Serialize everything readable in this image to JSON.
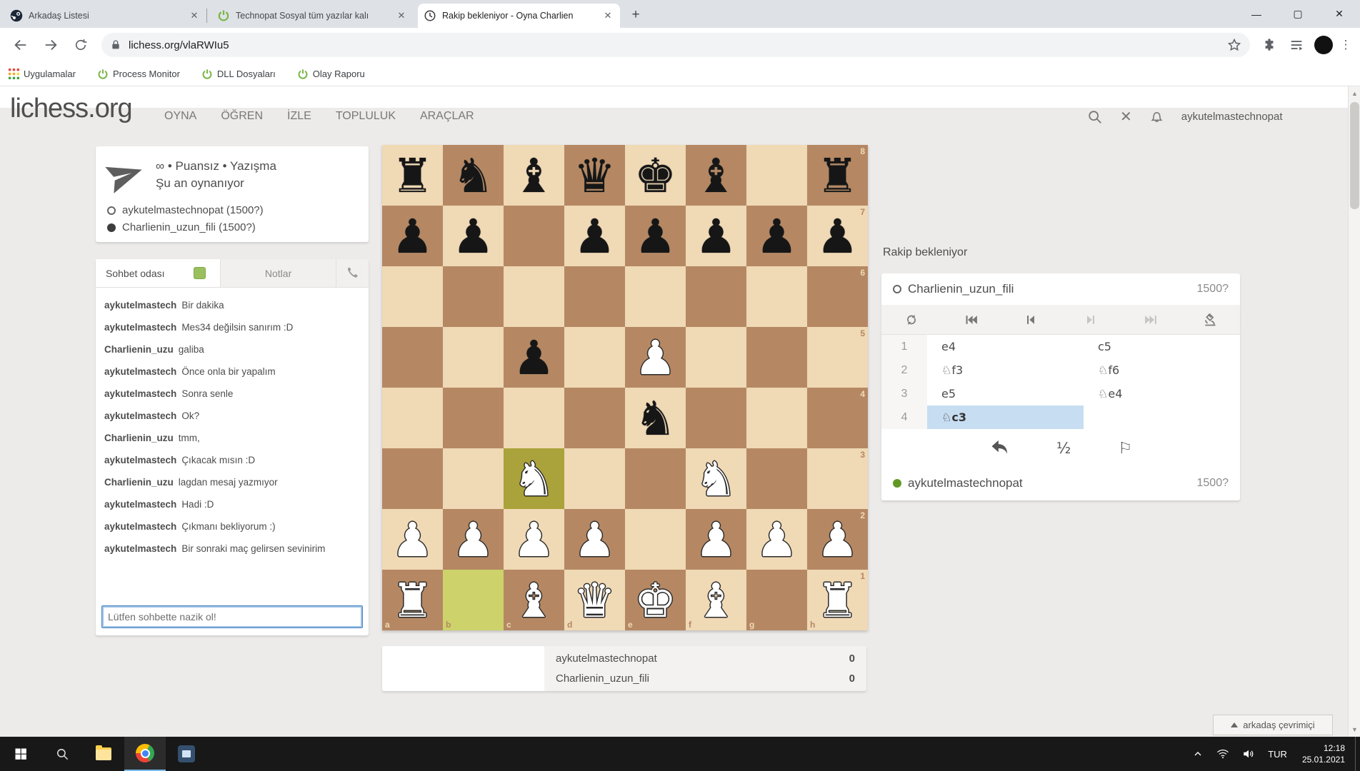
{
  "browser": {
    "tabs": [
      {
        "title": "Arkadaş Listesi"
      },
      {
        "title": "Technopat Sosyal tüm yazılar kalı"
      },
      {
        "title": "Rakip bekleniyor - Oyna Charlien"
      }
    ],
    "url": "lichess.org/vlaRWIu5",
    "bookmarks": {
      "apps": "Uygulamalar",
      "items": [
        "Process Monitor",
        "DLL Dosyaları",
        "Olay Raporu"
      ]
    }
  },
  "lichess": {
    "logo": "lichess.org",
    "nav": [
      "OYNA",
      "ÖĞREN",
      "İZLE",
      "TOPLULUK",
      "ARAÇLAR"
    ],
    "header_username": "aykutelmastechnopat",
    "game_meta": {
      "mode_line": "∞ • Puansız • Yazışma",
      "status_line": "Şu an oynanıyor",
      "white_player": "aykutelmastechnopat (1500?)",
      "black_player": "Charlienin_uzun_fili (1500?)"
    },
    "chat": {
      "tab_chat": "Sohbet odası",
      "tab_notes": "Notlar",
      "input_placeholder": "Lütfen sohbette nazik ol!",
      "messages": [
        {
          "user": "aykutelmastech",
          "text": "Bir dakika"
        },
        {
          "user": "aykutelmastech",
          "text": "Mes34 değilsin sanırım :D"
        },
        {
          "user": "Charlienin_uzu",
          "text": "galiba"
        },
        {
          "user": "aykutelmastech",
          "text": "Önce onla bir yapalım"
        },
        {
          "user": "aykutelmastech",
          "text": "Sonra senle"
        },
        {
          "user": "aykutelmastech",
          "text": "Ok?"
        },
        {
          "user": "Charlienin_uzu",
          "text": "tmm,"
        },
        {
          "user": "aykutelmastech",
          "text": "Çıkacak mısın :D"
        },
        {
          "user": "Charlienin_uzu",
          "text": "lagdan mesaj yazmıyor"
        },
        {
          "user": "aykutelmastech",
          "text": "Hadi :D"
        },
        {
          "user": "aykutelmastech",
          "text": "Çıkmanı bekliyorum :)"
        },
        {
          "user": "aykutelmastech",
          "text": "Bir sonraki maç gelirsen sevinirim"
        }
      ]
    },
    "side": {
      "status": "Rakip bekleniyor",
      "opponent": {
        "name": "Charlienin_uzun_fili",
        "rating": "1500?"
      },
      "player": {
        "name": "aykutelmastechnopat",
        "rating": "1500?"
      },
      "moves": [
        {
          "n": "1",
          "w": "e4",
          "b": "c5"
        },
        {
          "n": "2",
          "w": "♘f3",
          "b": "♘f6"
        },
        {
          "n": "3",
          "w": "e5",
          "b": "♘e4"
        },
        {
          "n": "4",
          "w": "♘c3",
          "b": ""
        }
      ],
      "active": {
        "row": 3,
        "side": "w"
      },
      "draw_label": "½"
    },
    "score": {
      "rows": [
        {
          "name": "aykutelmastechnopat",
          "value": "0"
        },
        {
          "name": "Charlienin_uzun_fili",
          "value": "0"
        }
      ]
    },
    "board": {
      "rows": [
        "rnbqkb.r",
        "pp.ppppp",
        "........",
        "..p.P...",
        "....n...",
        "..N..N..",
        "PPPP.PPP",
        "R.BQKB.R"
      ],
      "highlights": [
        "b1",
        "c3"
      ],
      "files": [
        "a",
        "b",
        "c",
        "d",
        "e",
        "f",
        "g",
        "h"
      ],
      "ranks": [
        "8",
        "7",
        "6",
        "5",
        "4",
        "3",
        "2",
        "1"
      ],
      "colors": {
        "light": "#f0d9b5",
        "dark": "#b58863",
        "hl_light": "#cdd26b",
        "hl_dark": "#aaa23a"
      }
    }
  },
  "friends_bar_label": "arkadaş çevrimiçi",
  "taskbar": {
    "lang": "TUR",
    "time": "12:18",
    "date": "25.01.2021"
  }
}
